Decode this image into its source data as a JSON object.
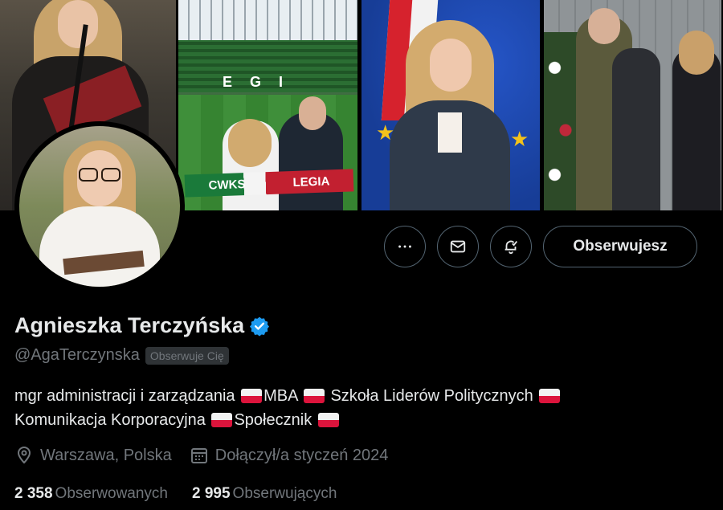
{
  "profile": {
    "name": "Agnieszka Terczyńska",
    "handle": "@AgaTerczynska",
    "follows_you_badge": "Obserwuje Cię",
    "bio_line1": [
      "mgr administracji i zarządzania ",
      "MBA ",
      " Szkoła Liderów Politycznych "
    ],
    "bio_line2": [
      "Komunikacja Korporacyjna ",
      "Społecznik "
    ],
    "location": "Warszawa, Polska",
    "joined": "Dołączył/a styczeń 2024",
    "following_count": "2 358",
    "following_label": "Obserwowanych",
    "followers_count": "2 995",
    "followers_label": "Obserwujących"
  },
  "actions": {
    "follow_label": "Obserwujesz",
    "more_icon": "more-icon",
    "message_icon": "mail-icon",
    "notify_icon": "bell-check-icon"
  },
  "banner": {
    "scarf_left": "CWKS",
    "scarf_right": "LEGIA",
    "stadium_letters": "EGI"
  },
  "colors": {
    "background": "#000000",
    "text_primary": "#e7e9ea",
    "text_secondary": "#71767b",
    "border": "#536471",
    "verified": "#1d9bf0"
  }
}
